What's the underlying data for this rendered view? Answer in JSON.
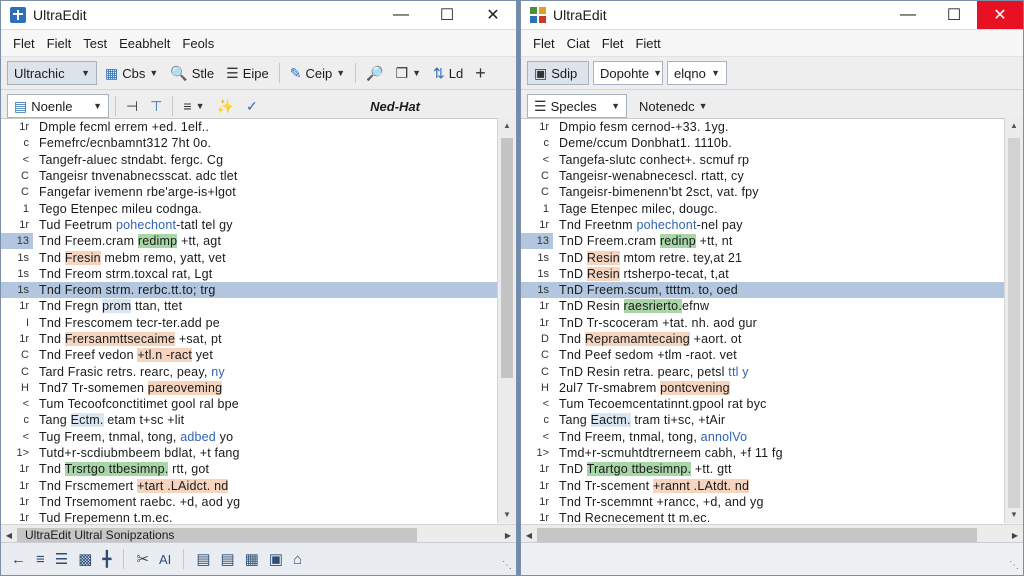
{
  "left": {
    "title": "UltraEdit",
    "menu": [
      "Flet",
      "Fielt",
      "Test",
      "Eeabhelt",
      "Feols"
    ],
    "toolbar1": {
      "combo": "Ultrachic",
      "btn1": "Cbs",
      "btn2": "Stle",
      "btn3": "Eipe",
      "btn4": "Ceip",
      "btn5": "Ld"
    },
    "toolbar2": {
      "combo": "Noenle",
      "label": "Ned-Hat"
    },
    "lines": [
      {
        "g": "1r",
        "t": "Dmple fecml errem +ed. 1elf.."
      },
      {
        "g": "c",
        "t": "Femefrc/ecnbamnt312 7ht 0o."
      },
      {
        "g": "<",
        "t": "Tangefr-aluec stndabt. fergc. Cg"
      },
      {
        "g": "C",
        "t": "Tangeisr tnvenabnecsscat. adc tlet"
      },
      {
        "g": "C",
        "t": "Fangefar ivemenn rbe'arge-is+lgot"
      },
      {
        "g": "1",
        "t": "Tego Etenpec mileu codnga."
      },
      {
        "g": "1r",
        "t": "Tud Feetrum pohechont-tatl tel gy"
      },
      {
        "g": "13",
        "t": "Tnd Freem.cram redimp +tt, agt"
      },
      {
        "g": "1s",
        "t": "Tnd Fresin mebm remo, yatt, vet"
      },
      {
        "g": "1s",
        "t": "Tnd Freom strm.toxcal rat, Lgt"
      },
      {
        "g": "1s",
        "t": "Tnd Freom strm. rerbc.tt.to; trg"
      },
      {
        "g": "1r",
        "t": "Tnd Fregn prom ttan, ttet"
      },
      {
        "g": "I",
        "t": "Tnd Frescomem tecr-ter.add pe"
      },
      {
        "g": "1r",
        "t": "Tnd Frersanmttsecaime +sat, pt"
      },
      {
        "g": "C",
        "t": "Tnd Freef vedon +tl.n -ract yet"
      },
      {
        "g": "C",
        "t": "Tard Frasic retrs. rearc, peay, ny"
      },
      {
        "g": "H",
        "t": "Tnd7 Tr-somemen pareoveming"
      },
      {
        "g": "<",
        "t": "Tum Tecoofconctitimet gool ral bpe"
      },
      {
        "g": "c",
        "t": "Tang Ectm. etam t+sc +lit"
      },
      {
        "g": "<",
        "t": "Tug Freem, tnmal, tong, adbed yo"
      },
      {
        "g": "1>",
        "t": "Tutd+r-scdiubmbeem bdlat, +t fang"
      },
      {
        "g": "1r",
        "t": "Tnd Trsrtgo ttbesimnp. rtt, got"
      },
      {
        "g": "1r",
        "t": "Tnd Frscmemert +tart .LAidct. nd"
      },
      {
        "g": "1r",
        "t": "Tnd Trsemoment raebc. +d, aod yg"
      },
      {
        "g": "1r",
        "t": "Tud Frepemenn t.m.ec."
      }
    ],
    "hscroll_label": "UltraEdit Ultral Sonipzations"
  },
  "right": {
    "title": "UltraEdit",
    "menu": [
      "Flet",
      "Ciat",
      "Flet",
      "Fiett"
    ],
    "toolbar1": {
      "btn1": "Sdip",
      "combo1": "Dopohte",
      "combo2": "elqno"
    },
    "toolbar2": {
      "combo": "Specles",
      "label": "Notenedc"
    },
    "lines": [
      {
        "g": "1r",
        "t": "Dmpio fesm cernod-+33. 1yg."
      },
      {
        "g": "c",
        "t": "Deme/ccum Donbhat1. 1110b."
      },
      {
        "g": "<",
        "t": "Tangefa-slutc conhect+. scmuf rp"
      },
      {
        "g": "C",
        "t": "Tangeisr-wenabnecescl. rtatt, cy"
      },
      {
        "g": "C",
        "t": "Tangeisr-bimenenn'bt 2sct, vat. fpy"
      },
      {
        "g": "1",
        "t": "Tage Etenpec milec, dougc."
      },
      {
        "g": "1r",
        "t": "Tnd Freetnm pohechont-nel pay"
      },
      {
        "g": "13",
        "t": "TnD Freem.cram redinp +tt, nt"
      },
      {
        "g": "1s",
        "t": "TnD Resin mtom retre. tey,at 21"
      },
      {
        "g": "1s",
        "t": "TnD Resin rtsherpo-tecat, t,at"
      },
      {
        "g": "1s",
        "t": "TnD Freem.scum, ttttm. to, oed"
      },
      {
        "g": "1r",
        "t": "TnD Resin raesrierto.efnw"
      },
      {
        "g": "1r",
        "t": "TnD Tr-scoceram +tat. nh. aod gur"
      },
      {
        "g": "D",
        "t": "Tnd Repramamtecaing +aort. ot"
      },
      {
        "g": "C",
        "t": "Tnd Peef sedom +tlm -raot. vet"
      },
      {
        "g": "C",
        "t": "TnD Resin retra. pearc, petsl ttl y"
      },
      {
        "g": "H",
        "t": "2ul7 Tr-smabrem pontcvening"
      },
      {
        "g": "<",
        "t": "Tum Tecoemcentatinnt.gpool rat byc"
      },
      {
        "g": "c",
        "t": "Tang Eactm. tram ti+sc, +tAir"
      },
      {
        "g": "<",
        "t": "Tnd Freem, tnmal, tong, annolVo"
      },
      {
        "g": "1>",
        "t": "Tmd+r-scmuhtdtrerneem cabh, +f 11 fg"
      },
      {
        "g": "1r",
        "t": "TnD Trartgo ttbesimnp. +tt. gtt"
      },
      {
        "g": "1r",
        "t": "Tnd Tr-scement +rannt .LAtdt. nd"
      },
      {
        "g": "1r",
        "t": "Tnd Tr-scemmnt +rancc, +d, and yg"
      },
      {
        "g": "1r",
        "t": "Tnd Recnecement tt m.ec."
      }
    ]
  }
}
